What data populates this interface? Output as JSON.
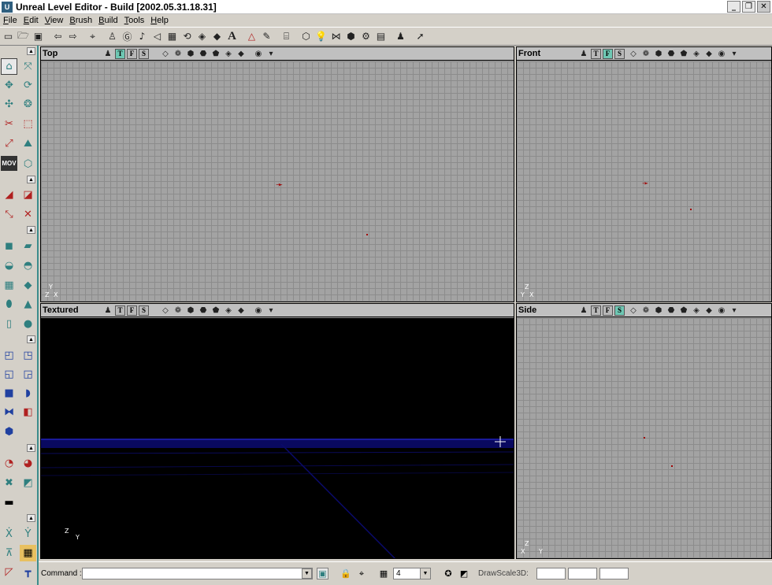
{
  "window": {
    "title": "Unreal Level Editor - Build [2002.05.31.18.31]",
    "app_icon": "U",
    "buttons": [
      "_",
      "❐",
      "✕"
    ]
  },
  "menu": [
    "File",
    "Edit",
    "View",
    "Brush",
    "Build",
    "Tools",
    "Help"
  ],
  "toolbar": {
    "icons": [
      "new-file-icon",
      "open-folder-icon",
      "save-disk-icon",
      "undo-arrow-icon",
      "redo-arrow-icon",
      "binoculars-search-icon",
      "actor-class-icon",
      "group-browser-icon",
      "sound-browser-icon",
      "music-browser-icon",
      "texture-browser-icon",
      "mesh-browser-icon",
      "prefab-browser-icon",
      "static-mesh-browser-icon",
      "font-browser-icon",
      "2d-shape-editor-icon",
      "unrealscript-icon",
      "build-geometry-icon",
      "build-lighting-icon",
      "build-paths-icon",
      "build-all-icon",
      "build-options-icon",
      "play-level-icon",
      "select-cursor-icon"
    ],
    "font_glyph": "A"
  },
  "viewports": [
    {
      "id": "top",
      "title": "Top",
      "letters": [
        "T",
        "F",
        "S"
      ],
      "active": 0,
      "axis_v": "Y",
      "axis_h": "X",
      "axis_corner": "Z"
    },
    {
      "id": "front",
      "title": "Front",
      "letters": [
        "T",
        "F",
        "S"
      ],
      "active": 1,
      "axis_v": "Z",
      "axis_h": "X",
      "axis_corner": "Y"
    },
    {
      "id": "textured",
      "title": "Textured",
      "letters": [
        "T",
        "F",
        "S"
      ],
      "active": -1,
      "axis_v": "Z",
      "axis_h": "Y",
      "axis_corner": ""
    },
    {
      "id": "side",
      "title": "Side",
      "letters": [
        "T",
        "F",
        "S"
      ],
      "active": 2,
      "axis_v": "Z",
      "axis_h": "Y",
      "axis_corner": "X"
    }
  ],
  "statusbar": {
    "command_label": "Command :",
    "command_value": "",
    "grid_size": "4",
    "drawscale_label": "DrawScale3D:",
    "drawscale_x": "",
    "drawscale_y": "",
    "drawscale_z": ""
  },
  "colors": {
    "toolbox_accent": "#3c8c8c",
    "grid_background": "#a3a3a3",
    "textured_background": "#000000",
    "active_view_button": "#6ec7b3"
  }
}
